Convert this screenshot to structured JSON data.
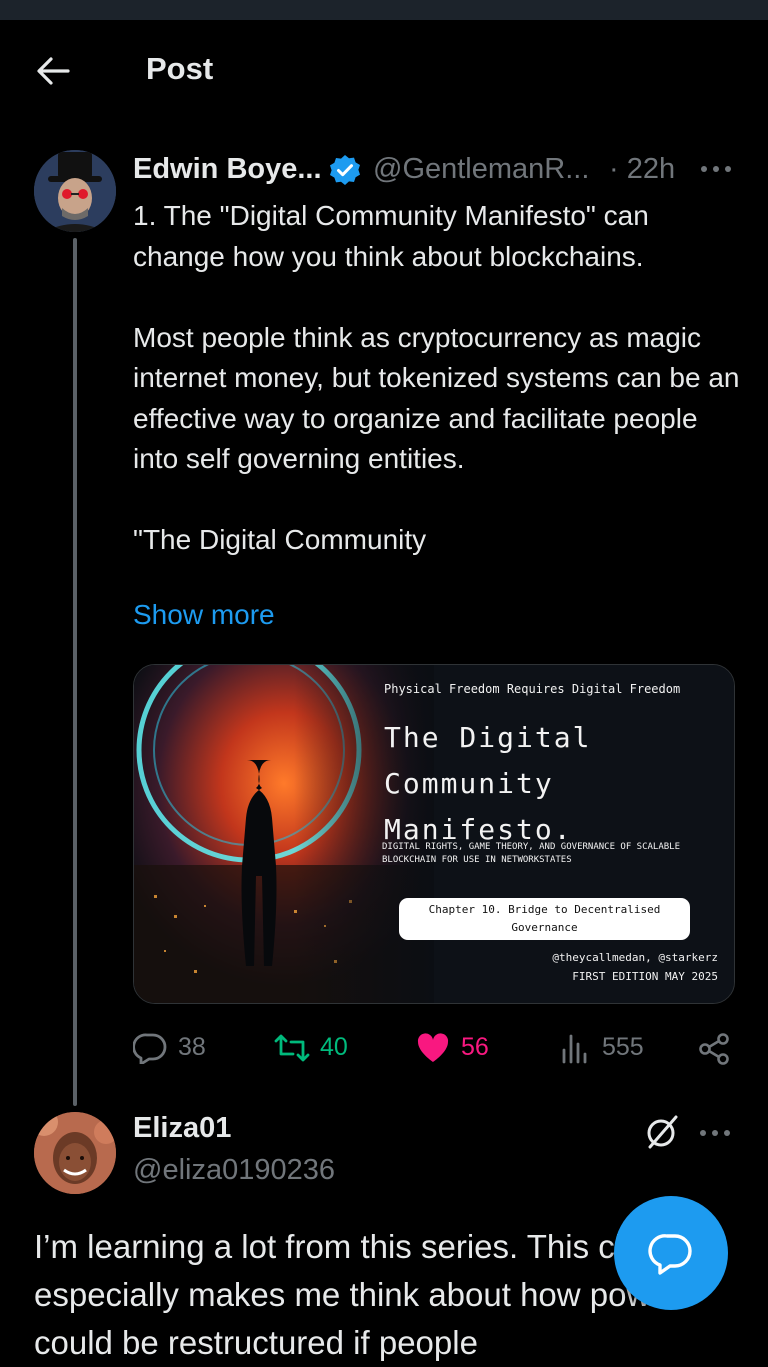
{
  "header": {
    "title": "Post"
  },
  "post": {
    "author_name": "Edwin Boye...",
    "handle": "@GentlemanR...",
    "time": "· 22h",
    "paragraphs": [
      "1. The \"Digital Community Manifesto\" can change how you think about blockchains.",
      "Most people think as cryptocurrency as magic internet money, but tokenized systems can be an effective way to organize and facilitate people into self governing entities.",
      "\"The Digital Community"
    ],
    "show_more": "Show more",
    "media": {
      "tagline": "Physical Freedom Requires Digital Freedom",
      "title_lines": [
        "The Digital",
        "Community",
        "Manifesto."
      ],
      "subtitle_lines": [
        "DIGITAL RIGHTS, GAME THEORY, AND GOVERNANCE OF SCALABLE",
        "BLOCKCHAIN FOR USE IN NETWORKSTATES"
      ],
      "chapter_lines": [
        "Chapter 10. Bridge to Decentralised",
        "Governance"
      ],
      "authors": "@theycallmedan, @starkerz",
      "edition": "FIRST EDITION MAY 2025"
    },
    "stats": {
      "replies": "38",
      "reposts": "40",
      "likes": "56",
      "views": "555"
    },
    "colors": {
      "repost": "#00ba7c",
      "like": "#f91880",
      "link": "#1d9bf0",
      "verified": "#1d9bf0"
    }
  },
  "reply": {
    "name": "Eliza01",
    "handle": "@eliza0190236",
    "text": "I’m learning a lot from this series. This chapter especially makes me think about how power could be restructured if people"
  },
  "icons": [
    "back-arrow-icon",
    "verified-badge-icon",
    "more-icon",
    "reply-icon",
    "repost-icon",
    "heart-icon",
    "views-icon",
    "share-icon",
    "grok-icon",
    "compose-reply-icon"
  ]
}
